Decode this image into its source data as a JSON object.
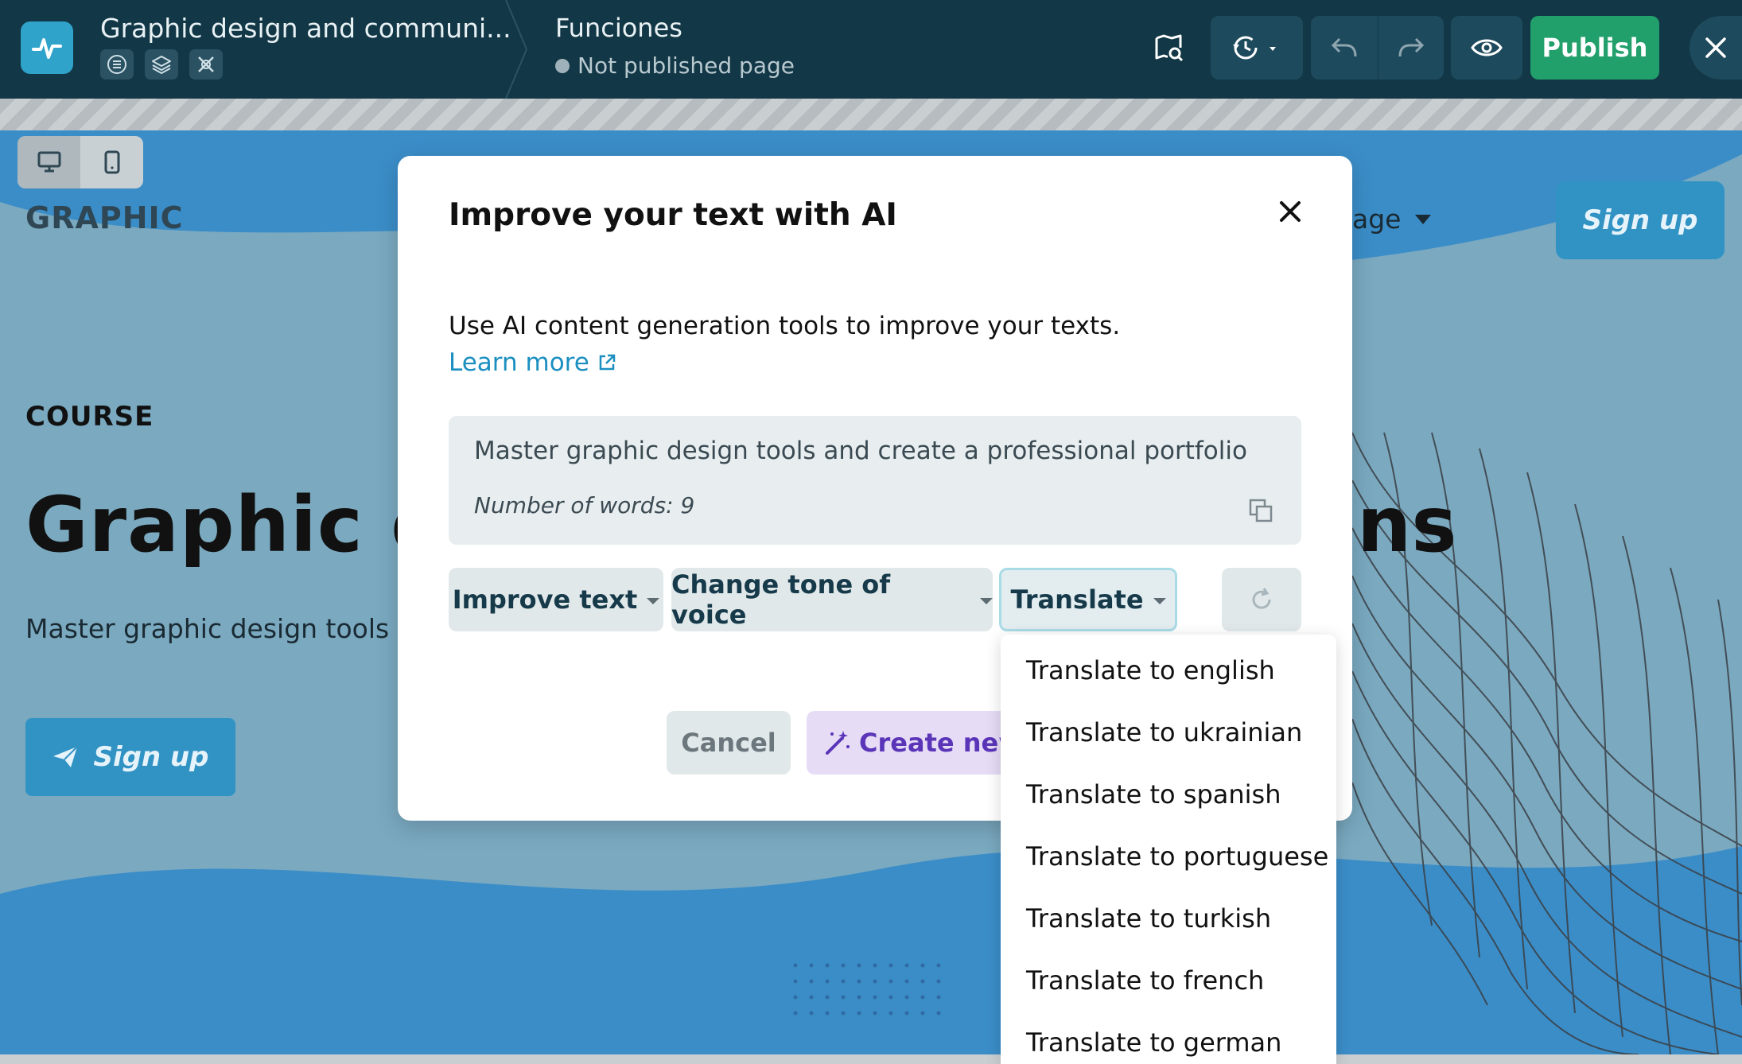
{
  "editor": {
    "site_title": "Graphic design and communi...",
    "page_name": "Funciones",
    "page_status": "Not published page",
    "publish_label": "Publish"
  },
  "preview": {
    "brand": "GRAPHIC",
    "nav_language_partial": "age",
    "nav_signup": "Sign up",
    "course_label": "COURSE",
    "hero_title_visible": "Graphic d",
    "hero_title_end": "ns",
    "hero_subtitle_visible": "Master graphic design tools a",
    "hero_signup": "Sign up"
  },
  "modal": {
    "title": "Improve your text with AI",
    "description": "Use AI content generation tools to improve your texts.",
    "learn_more": "Learn more",
    "source_text": "Master graphic design tools and create a professional portfolio",
    "word_count": "Number of words: 9",
    "actions": {
      "improve": "Improve text",
      "tone": "Change tone of voice",
      "translate": "Translate"
    },
    "cancel": "Cancel",
    "create_new": "Create new"
  },
  "translate_menu": [
    "Translate to english",
    "Translate to ukrainian",
    "Translate to spanish",
    "Translate to portuguese",
    "Translate to turkish",
    "Translate to french",
    "Translate to german"
  ],
  "colors": {
    "topbar": "#123746",
    "publish": "#22a06b",
    "accent_blue": "#3193c4",
    "link": "#1b8fc0",
    "create_new_text": "#5b35b8"
  }
}
